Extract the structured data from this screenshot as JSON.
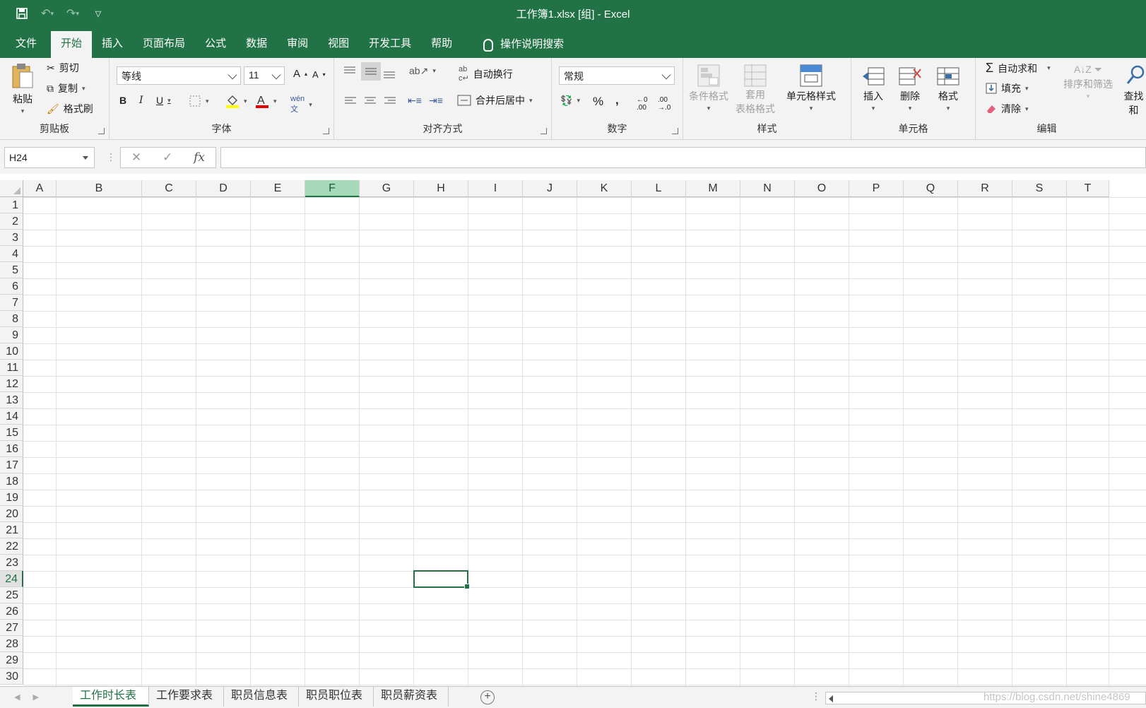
{
  "window": {
    "title": "工作簿1.xlsx  [组]  -  Excel",
    "accent": "#217346"
  },
  "qat": {
    "save_icon": "save-icon",
    "undo_icon": "undo-icon",
    "redo_icon": "redo-icon",
    "customize_icon": "customize-qat-icon"
  },
  "tabs": {
    "items": [
      "文件",
      "开始",
      "插入",
      "页面布局",
      "公式",
      "数据",
      "审阅",
      "视图",
      "开发工具",
      "帮助"
    ],
    "active": "开始",
    "tellme": "操作说明搜索"
  },
  "ribbon": {
    "clipboard": {
      "paste": "粘贴",
      "cut": "剪切",
      "copy": "复制",
      "format_painter": "格式刷",
      "label": "剪贴板"
    },
    "font": {
      "name": "等线",
      "size": "11",
      "bold": "B",
      "italic": "I",
      "underline": "U",
      "label": "字体",
      "grow": "A",
      "shrink": "A",
      "phonetic": "wén\n文"
    },
    "alignment": {
      "wrap": "自动换行",
      "merge": "合并后居中",
      "label": "对齐方式"
    },
    "number": {
      "format": "常规",
      "percent": "%",
      "comma": ",",
      "label": "数字"
    },
    "styles": {
      "conditional": "条件格式",
      "table_line1": "套用",
      "table_line2": "表格格式",
      "cell_styles": "单元格样式",
      "label": "样式"
    },
    "cells": {
      "insert": "插入",
      "delete": "删除",
      "format": "格式",
      "label": "单元格"
    },
    "editing": {
      "autosum": "自动求和",
      "fill": "填充",
      "clear": "清除",
      "sort": "排序和筛选",
      "find": "查找和",
      "label": "编辑"
    }
  },
  "formula_bar": {
    "name_box": "H24",
    "fx": "fx",
    "value": ""
  },
  "grid": {
    "columns": [
      "A",
      "B",
      "C",
      "D",
      "E",
      "F",
      "G",
      "H",
      "I",
      "J",
      "K",
      "L",
      "M",
      "N",
      "O",
      "P",
      "Q",
      "R",
      "S",
      "T"
    ],
    "rows": [
      "1",
      "2",
      "3",
      "4",
      "5",
      "6",
      "7",
      "8",
      "9",
      "10",
      "11",
      "12",
      "13",
      "14",
      "15",
      "16",
      "17",
      "18",
      "19",
      "20",
      "21",
      "22",
      "23",
      "24",
      "25",
      "26",
      "27",
      "28",
      "29",
      "30"
    ],
    "highlighted_column": "F",
    "active_cell": "H24"
  },
  "sheets": {
    "tabs": [
      "工作时长表",
      "工作要求表",
      "职员信息表",
      "职员职位表",
      "职员薪资表"
    ],
    "active": "工作时长表",
    "add_label": "+"
  },
  "watermark": "https://blog.csdn.net/shine4869"
}
